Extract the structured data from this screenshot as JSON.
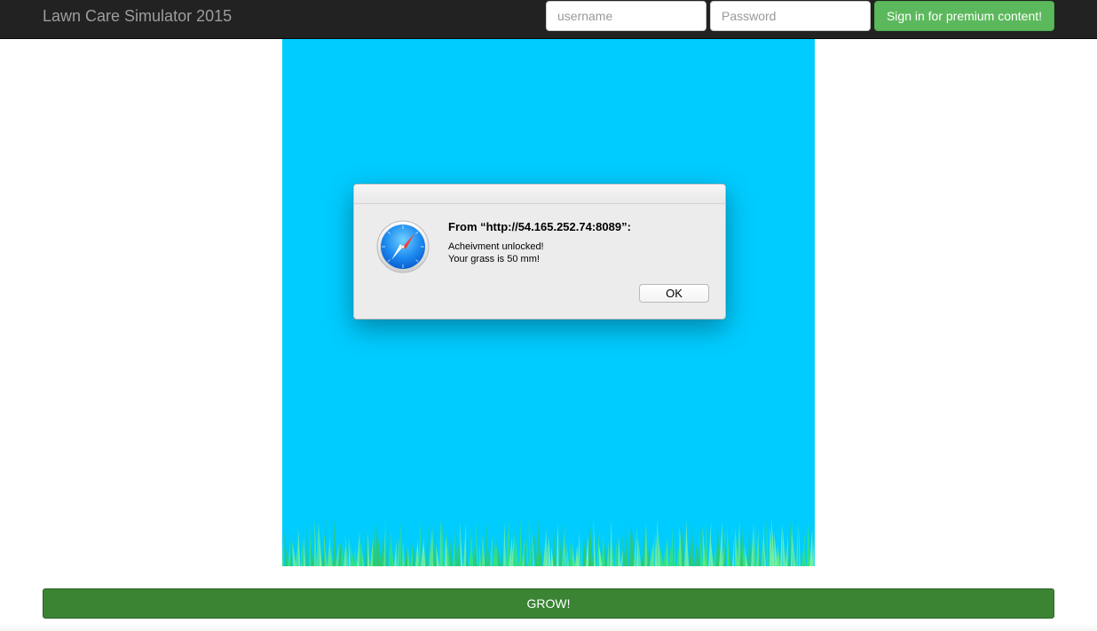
{
  "app": {
    "title": "Lawn Care Simulator 2015"
  },
  "login": {
    "username_placeholder": "username",
    "username_value": "",
    "password_placeholder": "Password",
    "password_value": "",
    "signin_label": "Sign in for premium content!"
  },
  "game": {
    "sky_color": "#00ccff",
    "grass_colors": [
      "#39e374",
      "#5ee885",
      "#2fc96a",
      "#7af09a"
    ],
    "grow_label": "GROW!"
  },
  "alert": {
    "icon": "safari-compass-icon",
    "heading": "From “http://54.165.252.74:8089”:",
    "lines": [
      "Acheivment unlocked!",
      "Your grass is 50 mm!"
    ],
    "ok_label": "OK"
  },
  "colors": {
    "navbar": "#222222",
    "success": "#5cb85c",
    "grow": "#3b8434"
  }
}
